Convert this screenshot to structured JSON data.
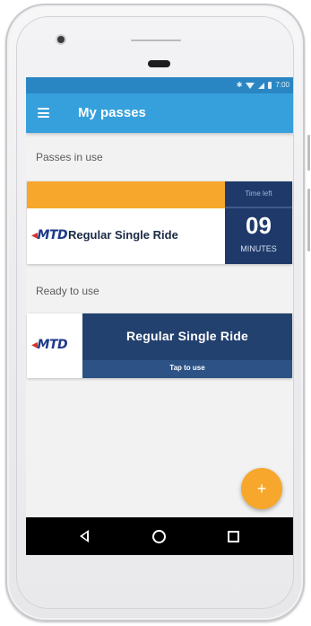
{
  "status_bar": {
    "icons": [
      "bluetooth-icon",
      "wifi-icon",
      "signal-icon",
      "battery-icon"
    ],
    "bluetooth_glyph": "✱",
    "time": "7:00"
  },
  "app_bar": {
    "menu_icon": "hamburger-menu-icon",
    "title": "My passes"
  },
  "passes_in_use": {
    "section_label": "Passes in use",
    "items": [
      {
        "logo_text": "MTD",
        "pass_name": "Regular Single Ride",
        "time_left_label": "Time left",
        "time_left_value": "09",
        "time_left_unit": "MINUTES"
      }
    ]
  },
  "ready_to_use": {
    "section_label": "Ready to use",
    "items": [
      {
        "logo_text": "MTD",
        "pass_name": "Regular Single Ride",
        "action_label": "Tap to use"
      }
    ]
  },
  "fab": {
    "icon": "plus-icon",
    "glyph": "+"
  },
  "nav_bar": {
    "icons": [
      "back-icon",
      "home-icon",
      "recent-apps-icon"
    ]
  },
  "colors": {
    "status_bar": "#2a86c2",
    "app_bar": "#36a0dc",
    "accent_orange": "#f6a72c",
    "pass_navy": "#1f3a6a",
    "ready_navy": "#23416f",
    "logo_blue": "#1e3a8a",
    "logo_red": "#d6332b"
  }
}
